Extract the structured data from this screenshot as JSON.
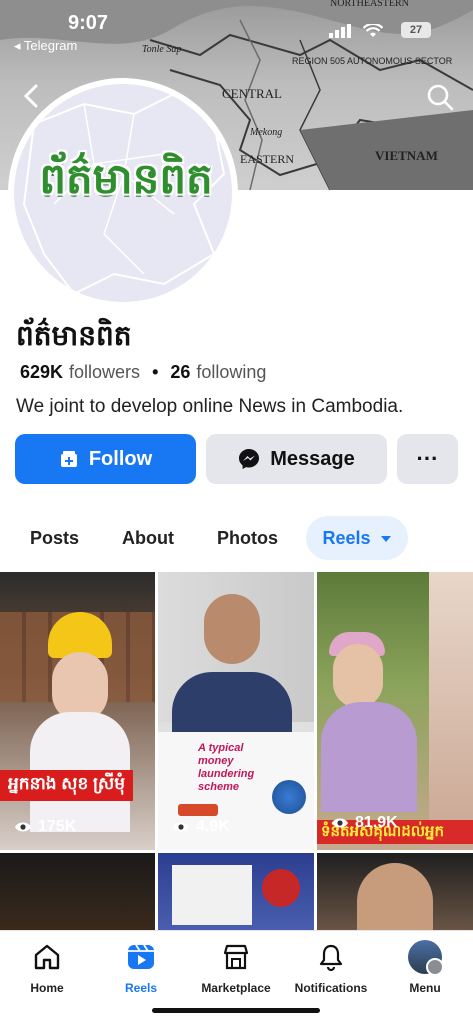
{
  "status_bar": {
    "time": "9:07",
    "back_app": "◂ Telegram",
    "battery": "27"
  },
  "cover": {
    "map_labels": [
      "NORTHEASTERN",
      "Tonle Sap",
      "REGION 505 AUTONOMOUS SECTOR",
      "CENTRAL",
      "Mekong",
      "EASTERN",
      "VIETNAM"
    ]
  },
  "profile": {
    "avatar_text": "ព័ត៌មានពិត",
    "name": "ព័ត៌មានពិត",
    "followers_count": "629K",
    "followers_label": "followers",
    "following_count": "26",
    "following_label": "following",
    "bio": "We joint to develop online News in Cambodia."
  },
  "actions": {
    "follow": "Follow",
    "message": "Message",
    "more": "···"
  },
  "tabs": [
    {
      "label": "Posts"
    },
    {
      "label": "About"
    },
    {
      "label": "Photos"
    },
    {
      "label": "Reels"
    }
  ],
  "reels": [
    {
      "views": "175K",
      "caption": "អ្នកនាង សុខ ស្រីមុំ"
    },
    {
      "views": "4.9K",
      "caption": "A typical money laundering scheme"
    },
    {
      "views": "81.9K",
      "caption": "ទំនិតអស់គុណដល់អ្នក"
    }
  ],
  "bottom_nav": [
    {
      "label": "Home",
      "icon": "home-icon"
    },
    {
      "label": "Reels",
      "icon": "reels-icon"
    },
    {
      "label": "Marketplace",
      "icon": "marketplace-icon"
    },
    {
      "label": "Notifications",
      "icon": "bell-icon"
    },
    {
      "label": "Menu",
      "icon": "menu-avatar-icon"
    }
  ],
  "colors": {
    "accent": "#1877f2",
    "button_gray": "#e4e6eb",
    "caption_red": "#d91c1c"
  }
}
